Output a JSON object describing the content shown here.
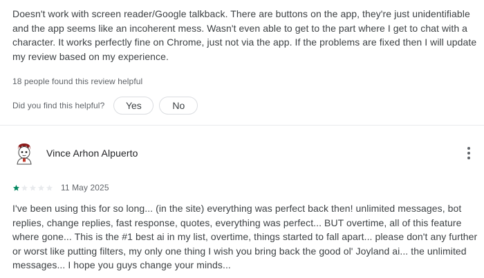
{
  "previous_review": {
    "text": "Doesn't work with screen reader/Google talkback. There are buttons on the app, they're just unidentifiable and the app seems like an incoherent mess. Wasn't even able to get to the part where I get to chat with a character. It works perfectly fine on Chrome, just not via the app. If the problems are fixed then I will update my review based on my experience.",
    "helpful_count": "18 people found this review helpful",
    "helpful_question": "Did you find this helpful?",
    "yes_label": "Yes",
    "no_label": "No"
  },
  "review": {
    "author": "Vince Arhon Alpuerto",
    "rating": 1,
    "max_rating": 5,
    "date": "11 May 2025",
    "text": "I've been using this for so long... (in the site) everything was perfect back then! unlimited messages, bot replies, change replies, fast response, quotes, everything was perfect... BUT overtime, all of this feature where gone... This is the #1 best ai in my list, overtime, things started to fall apart... please don't any further or worst like putting filters, my only one thing I wish you bring back the good ol' Joyland ai... the unlimited messages... I hope you guys change your minds...",
    "icons": {
      "avatar": "avatar-illustration",
      "menu": "more-vert-icon",
      "star": "star-icon"
    }
  },
  "colors": {
    "star_filled": "#01875f",
    "star_empty": "#e8eaed"
  }
}
